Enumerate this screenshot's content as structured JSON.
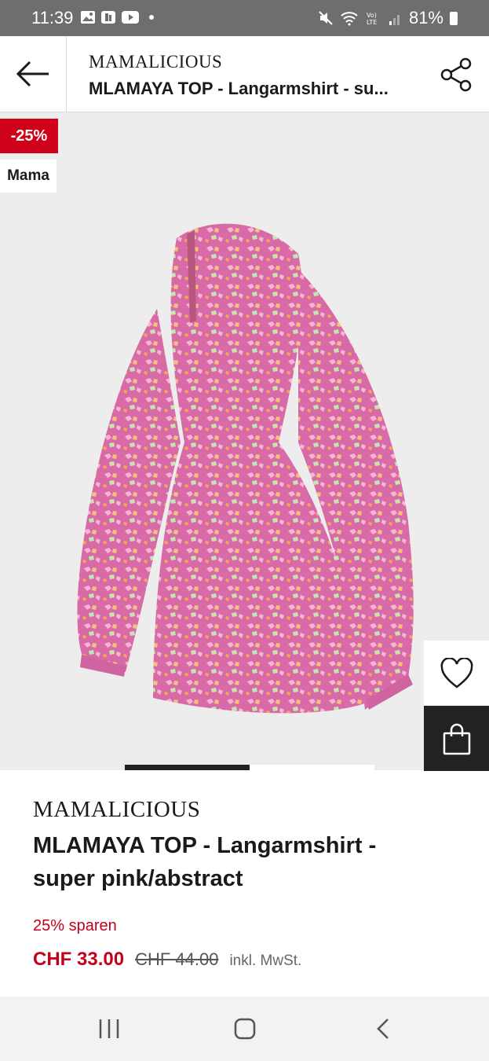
{
  "status_bar": {
    "time": "11:39",
    "battery": "81%"
  },
  "app_bar": {
    "brand": "MAMALICIOUS",
    "title": "MLAMAYA TOP - Langarmshirt - su..."
  },
  "gallery": {
    "discount_badge": "-25%",
    "tag_badge": "Mama",
    "current_image": 2,
    "image_count": 2
  },
  "product": {
    "brand": "MAMALICIOUS",
    "name": "MLAMAYA TOP - Langarmshirt - super pink/abstract",
    "savings": "25% sparen",
    "price_new": "CHF 33.00",
    "price_old": "CHF 44.00",
    "tax_note": "inkl. MwSt."
  },
  "icons": {
    "back": "arrow-left-icon",
    "share": "share-icon",
    "wishlist": "heart-icon",
    "bag": "shopping-bag-icon",
    "nav_recents": "recents-icon",
    "nav_home": "home-icon",
    "nav_back": "chevron-left-icon"
  },
  "colors": {
    "sale_red": "#c4001a",
    "badge_red": "#d0021b",
    "status_bar": "#6e6e6e",
    "product_pink": "#e07bb2"
  }
}
